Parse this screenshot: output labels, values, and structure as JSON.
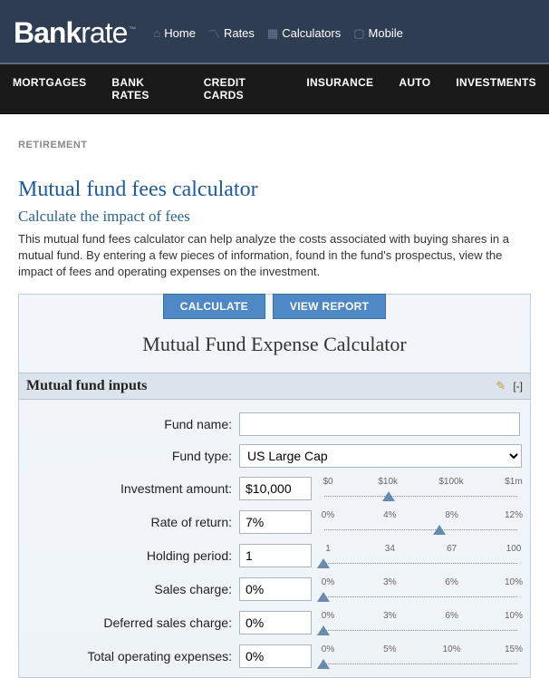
{
  "header": {
    "logo_main": "Bank",
    "logo_accent": "rate",
    "logo_tm": "™",
    "top_nav": [
      "Home",
      "Rates",
      "Calculators",
      "Mobile"
    ]
  },
  "main_nav": [
    "MORTGAGES",
    "BANK RATES",
    "CREDIT CARDS",
    "INSURANCE",
    "AUTO",
    "INVESTMENTS"
  ],
  "category": "RETIREMENT",
  "page_title": "Mutual fund fees calculator",
  "subtitle": "Calculate the impact of fees",
  "description": "This mutual fund fees calculator can help analyze the costs associated with buying shares in a mutual fund. By entering a few pieces of information, found in the fund's prospectus, view the impact of fees and operating expenses on the investment.",
  "buttons": {
    "calculate": "CALCULATE",
    "view_report": "VIEW REPORT"
  },
  "calc_title": "Mutual Fund Expense Calculator",
  "inputs_header": "Mutual fund inputs",
  "collapse_label": "[-]",
  "fields": {
    "fund_name": {
      "label": "Fund name:",
      "value": ""
    },
    "fund_type": {
      "label": "Fund type:",
      "value": "US Large Cap"
    },
    "investment_amount": {
      "label": "Investment amount:",
      "value": "$10,000",
      "ticks": [
        "$0",
        "$10k",
        "$100k",
        "$1m"
      ],
      "marker_pct": 34
    },
    "rate_of_return": {
      "label": "Rate of return:",
      "value": "7%",
      "ticks": [
        "0%",
        "4%",
        "8%",
        "12%"
      ],
      "marker_pct": 59
    },
    "holding_period": {
      "label": "Holding period:",
      "value": "1",
      "ticks": [
        "1",
        "34",
        "67",
        "100"
      ],
      "marker_pct": 2
    },
    "sales_charge": {
      "label": "Sales charge:",
      "value": "0%",
      "ticks": [
        "0%",
        "3%",
        "6%",
        "10%"
      ],
      "marker_pct": 2
    },
    "deferred_sales_charge": {
      "label": "Deferred sales charge:",
      "value": "0%",
      "ticks": [
        "0%",
        "3%",
        "6%",
        "10%"
      ],
      "marker_pct": 2
    },
    "total_operating_expenses": {
      "label": "Total operating expenses:",
      "value": "0%",
      "ticks": [
        "0%",
        "5%",
        "10%",
        "15%"
      ],
      "marker_pct": 2
    }
  }
}
